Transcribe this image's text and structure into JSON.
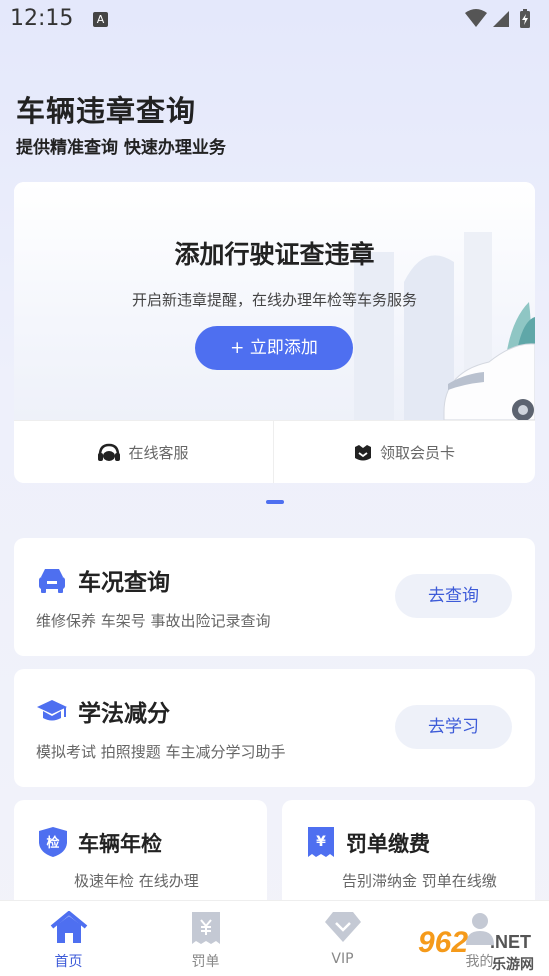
{
  "status": {
    "time": "12:15",
    "badge": "A"
  },
  "header": {
    "title": "车辆违章查询",
    "subtitle": "提供精准查询 快速办理业务"
  },
  "license_card": {
    "title": "添加行驶证查违章",
    "description": "开启新违章提醒，在线办理年检等车务服务",
    "add_button": "+ 立即添加",
    "actions": [
      {
        "label": "在线客服",
        "icon": "headset-icon"
      },
      {
        "label": "领取会员卡",
        "icon": "member-badge-icon"
      }
    ]
  },
  "features": [
    {
      "title": "车况查询",
      "description": "维修保养 车架号 事故出险记录查询",
      "button": "去查询",
      "icon": "car-icon"
    },
    {
      "title": "学法减分",
      "description": "模拟考试 拍照搜题 车主减分学习助手",
      "button": "去学习",
      "icon": "graduation-cap-icon"
    }
  ],
  "services": [
    {
      "title": "车辆年检",
      "description": "极速年检 在线办理",
      "icon": "inspection-shield-icon",
      "icon_text": "检"
    },
    {
      "title": "罚单缴费",
      "description": "告别滞纳金 罚单在线缴",
      "icon": "ticket-yen-icon",
      "icon_text": "¥"
    }
  ],
  "tabs": [
    {
      "label": "首页",
      "icon": "home-icon",
      "active": true
    },
    {
      "label": "罚单",
      "icon": "ticket-icon",
      "active": false
    },
    {
      "label": "VIP",
      "icon": "diamond-icon",
      "active": false
    },
    {
      "label": "我的",
      "icon": "profile-icon",
      "active": false
    }
  ],
  "watermark": {
    "brand": "962",
    "suffix": ".NET",
    "sub": "乐游网"
  },
  "colors": {
    "accent": "#4e6ff0",
    "accent_text": "#3d5bd8",
    "watermark": "#f59a1a"
  }
}
